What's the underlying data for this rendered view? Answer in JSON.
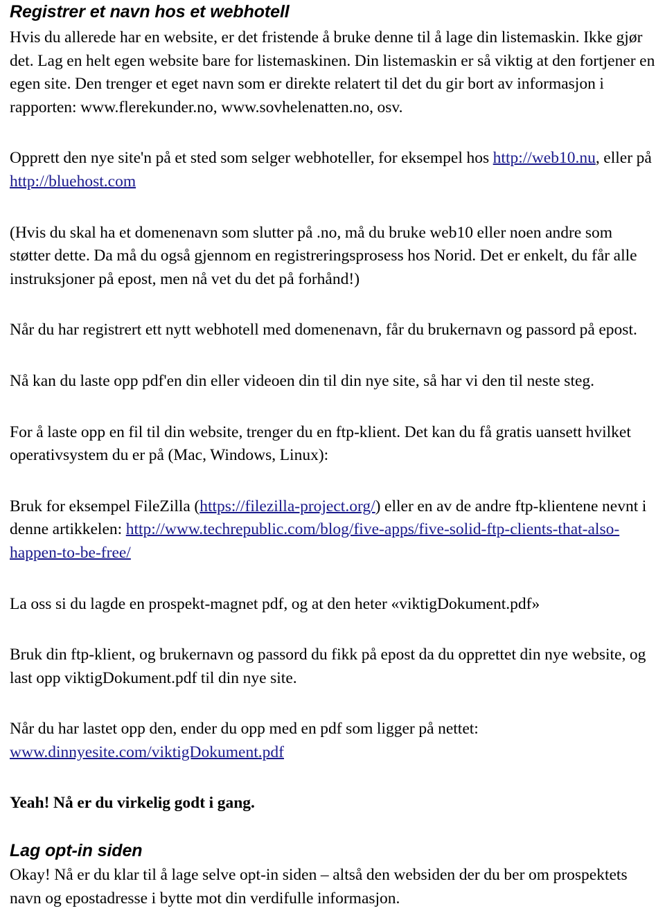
{
  "document": {
    "language": "no",
    "link_color": "#1a1a8c",
    "text_color": "#000000",
    "background_color": "#ffffff",
    "heading1": "Registrer et navn hos et webhotell",
    "heading2": "Lag opt-in siden",
    "paragraphs": {
      "intro": "Hvis du allerede har en website, er det fristende å bruke denne til å lage din listemaskin. Ikke gjør det. Lag en helt egen website bare for listemaskinen. Din listemaskin er så viktig at den fortjener en egen site. Den trenger et eget navn som er direkte relatert til det du gir bort av informasjon i rapporten: www.flerekunder.no, www.sovhelenatten.no, osv.",
      "opprett_prefix": "Opprett den nye site'n på et sted som selger webhoteller, for eksempel hos ",
      "opprett_middle": ", eller på ",
      "parenthetical": "(Hvis du skal ha et domenenavn som slutter på .no, må du bruke web10 eller noen andre som støtter dette. Da må du også gjennom en registreringsprosess hos Norid. Det er enkelt, du får alle instruksjoner på epost, men nå vet du det på forhånd!)",
      "registrert": "Når du har registrert ett nytt webhotell med domenenavn, får du brukernavn og passord på epost.",
      "laste_opp": "Nå kan du laste opp pdf'en din eller videoen din til din nye site, så har vi den til neste steg.",
      "ftp_klient": "For å laste opp en fil til din website, trenger du en ftp-klient. Det kan du få gratis uansett hvilket operativsystem du er på (Mac, Windows, Linux):",
      "filezilla_prefix": "Bruk for eksempel FileZilla (",
      "filezilla_middle": ") eller en av de andre ftp-klientene nevnt i denne artikkelen: ",
      "prospekt_magnet": "La oss si du lagde en prospekt-magnet pdf, og at den heter «viktigDokument.pdf»",
      "bruk_ftp": "Bruk din ftp-klient, og brukernavn og passord du fikk på epost da du opprettet din nye website, og last opp viktigDokument.pdf til din nye site.",
      "lastet_opp_prefix": "Når du har lastet opp den, ender du opp med en pdf som ligger på nettet:",
      "yeah": "Yeah! Nå er du virkelig godt i gang.",
      "okay": "Okay! Nå er du klar til å lage selve opt-in siden – altså den websiden der du ber om prospektets navn og epostadresse i bytte mot din verdifulle informasjon."
    },
    "links": {
      "web10": "http://web10.nu",
      "bluehost": "http://bluehost.com",
      "filezilla": "https://filezilla-project.org/",
      "techrepublic": "http://www.techrepublic.com/blog/five-apps/five-solid-ftp-clients-that-also-happen-to-be-free/",
      "dinnyesite": "www.dinnyesite.com/viktigDokument.pdf"
    }
  }
}
